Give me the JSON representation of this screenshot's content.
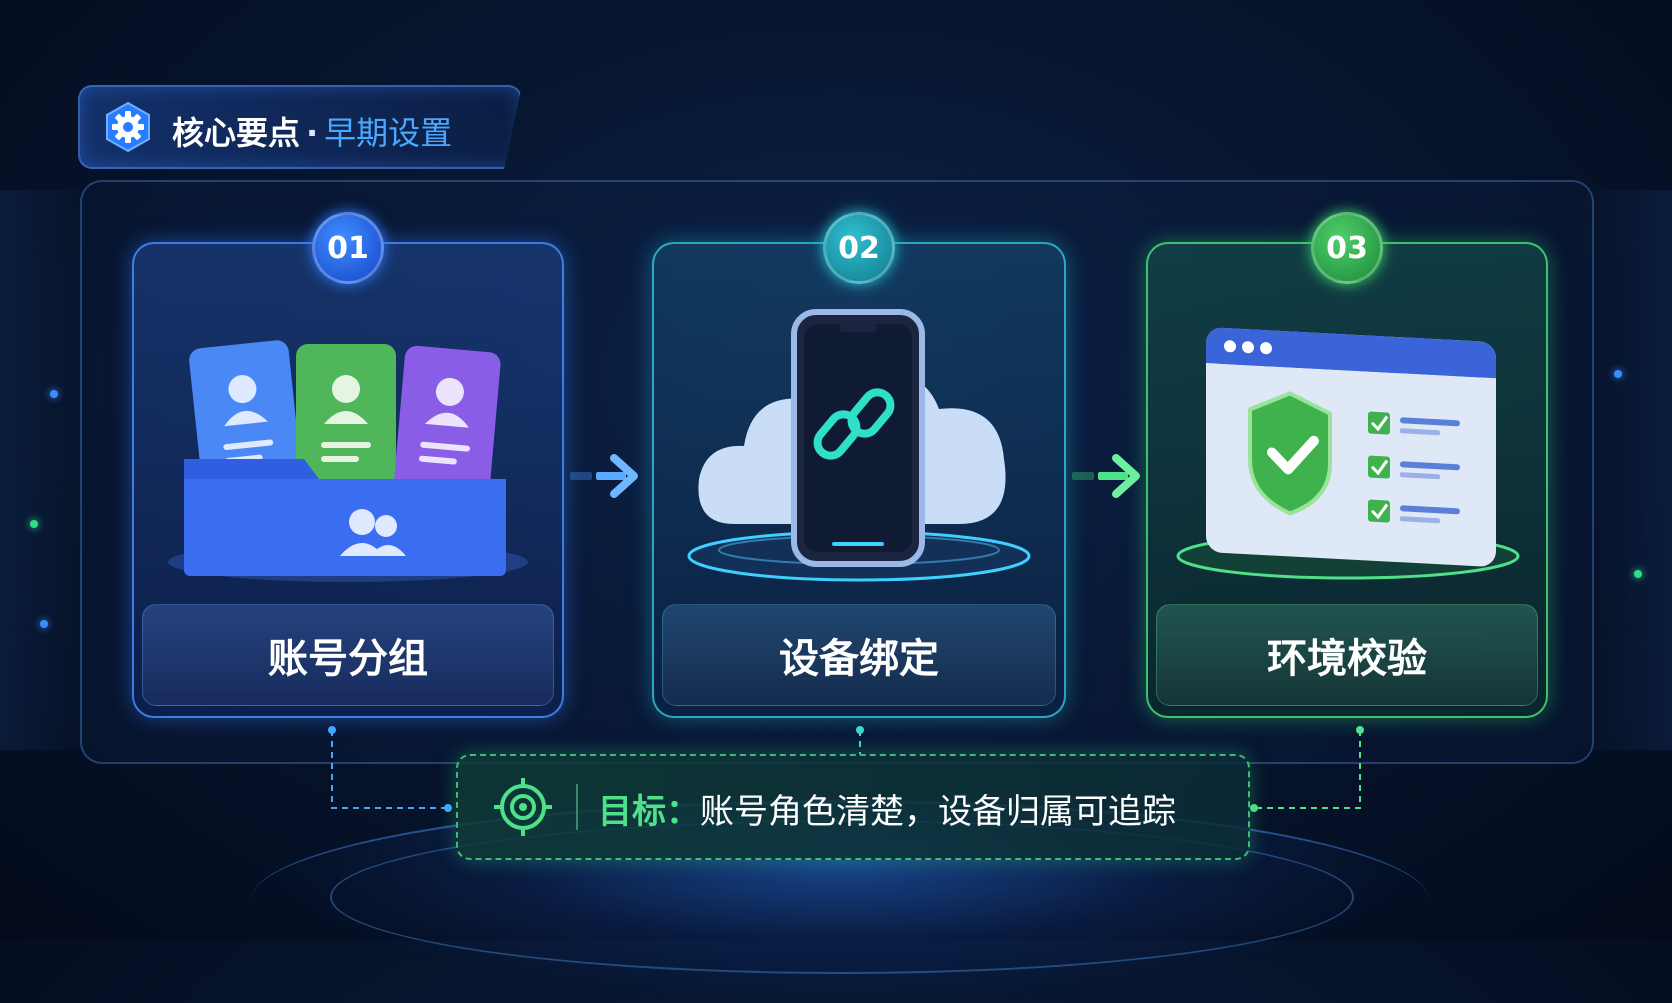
{
  "header": {
    "title": "核心要点",
    "separator": "·",
    "subtitle": "早期设置",
    "icon": "gear-icon"
  },
  "steps": [
    {
      "number": "01",
      "label": "账号分组",
      "icon": "account-folder-icon",
      "color": "#2f7bff"
    },
    {
      "number": "02",
      "label": "设备绑定",
      "icon": "phone-link-cloud-icon",
      "color": "#22c4d6"
    },
    {
      "number": "03",
      "label": "环境校验",
      "icon": "shield-check-window-icon",
      "color": "#39d36a"
    }
  ],
  "goal": {
    "label": "目标：",
    "text": "账号角色清楚，设备归属可追踪",
    "icon": "target-icon"
  },
  "colors": {
    "accent_blue": "#4aa8ff",
    "accent_cyan": "#22c4d6",
    "accent_green": "#4fe08a",
    "background": "#071630"
  }
}
